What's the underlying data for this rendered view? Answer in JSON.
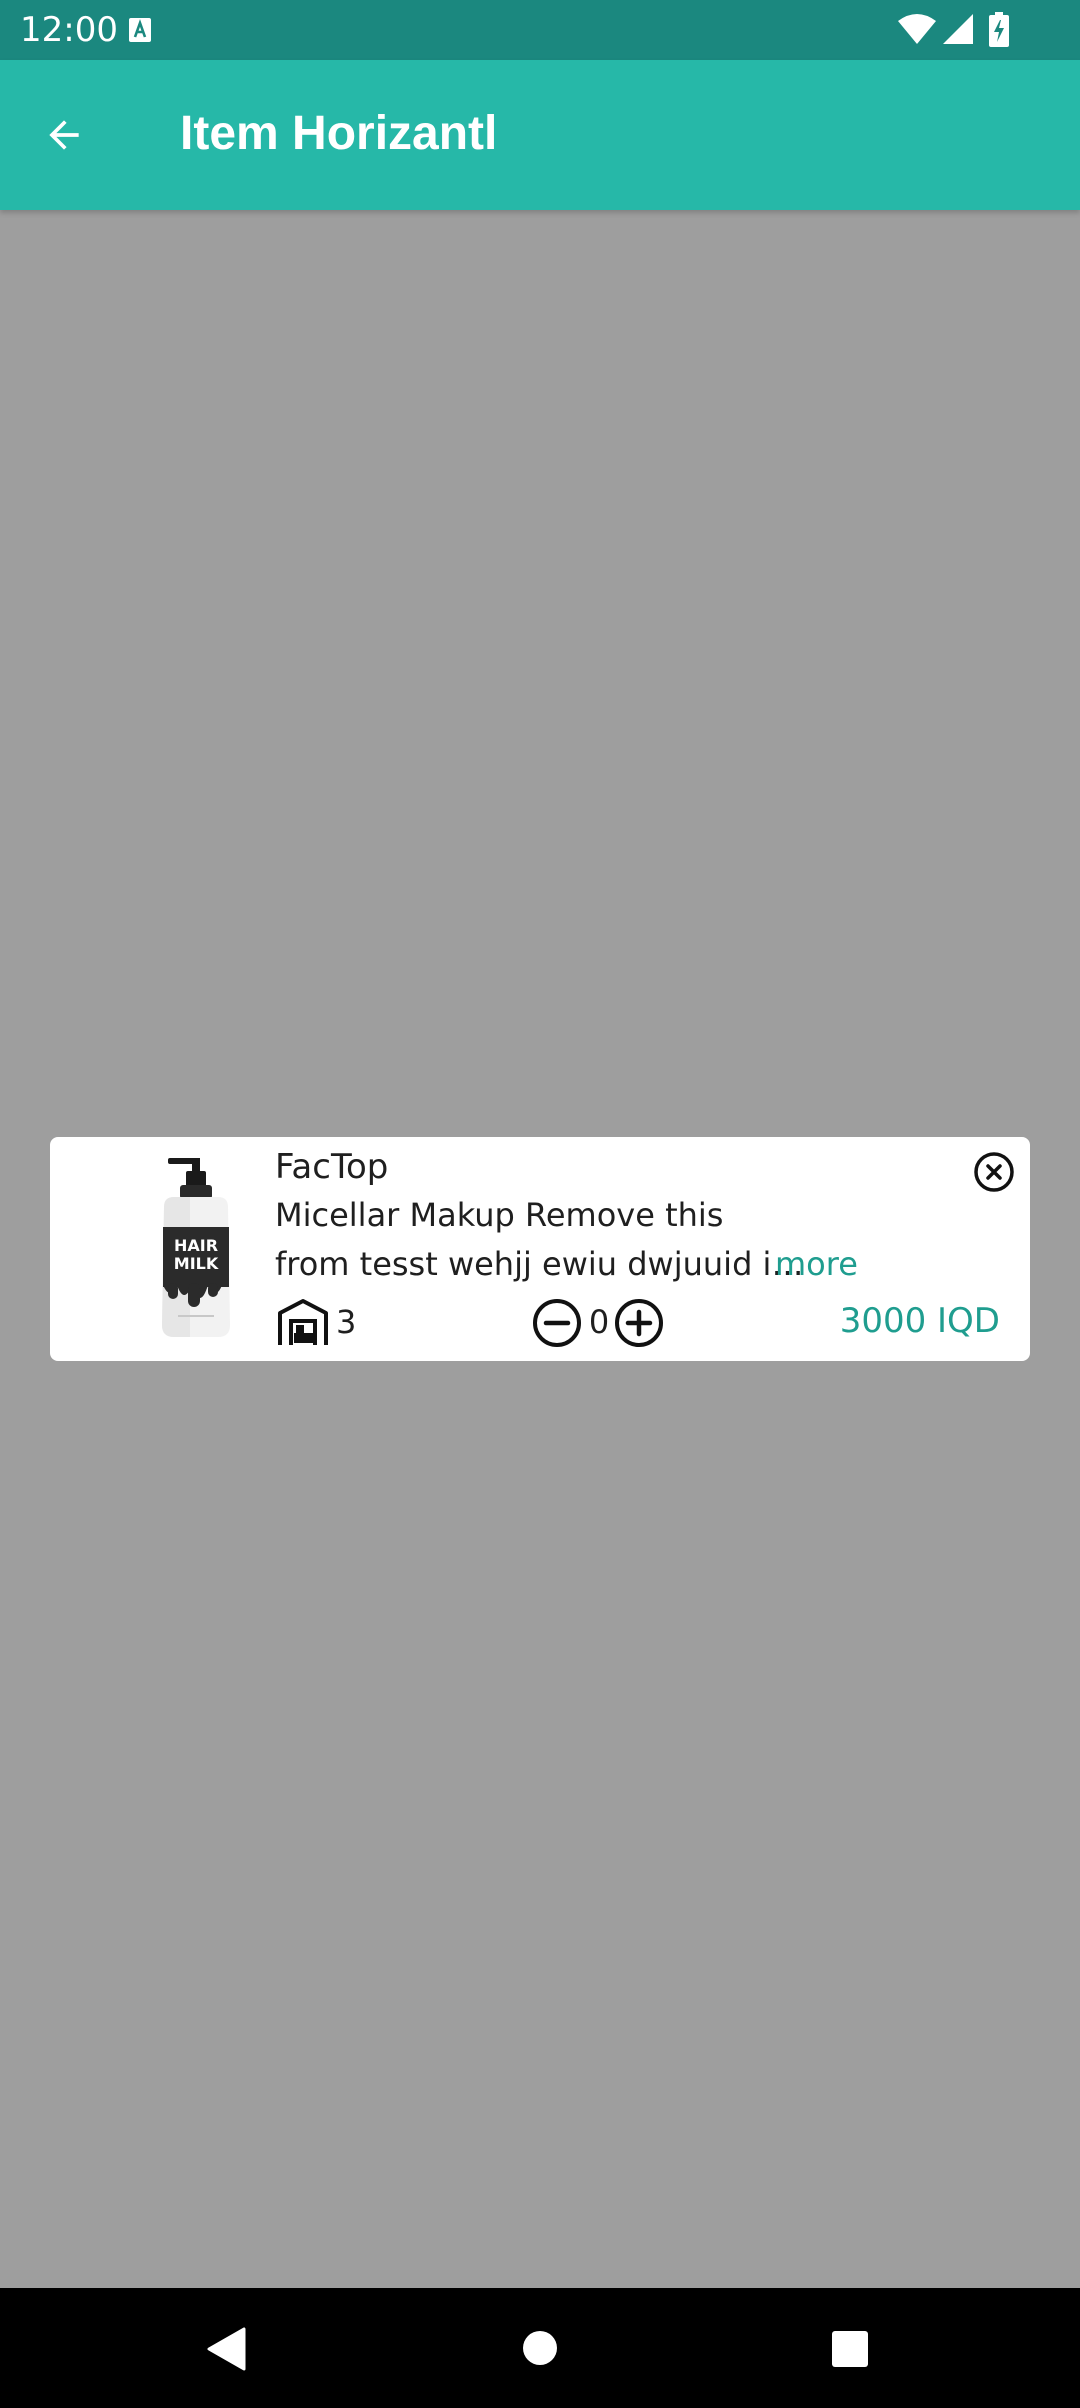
{
  "status_bar": {
    "time": "12:00",
    "notification_icon": "text-a-icon",
    "wifi_icon": "wifi-icon",
    "signal_icon": "cell-signal-icon",
    "battery_icon": "battery-charging-icon"
  },
  "app_bar": {
    "title": "Item Horizantl",
    "back_icon": "arrow-left-icon",
    "background_color": "#26b8a8"
  },
  "item": {
    "title": "FacTop",
    "description_line1": "Micellar Makup Remove this",
    "description_line2": "from tesst wehjj ewiu dwjuuid i…",
    "more_label": "more",
    "stock_count": "3",
    "quantity": "0",
    "price": "3000 IQD",
    "image_text_line1": "HAIR",
    "image_text_line2": "MILK",
    "accent_color": "#1f9d8f"
  },
  "nav_bar": {
    "back_icon": "triangle-back-icon",
    "home_icon": "circle-home-icon",
    "recents_icon": "square-recents-icon"
  }
}
